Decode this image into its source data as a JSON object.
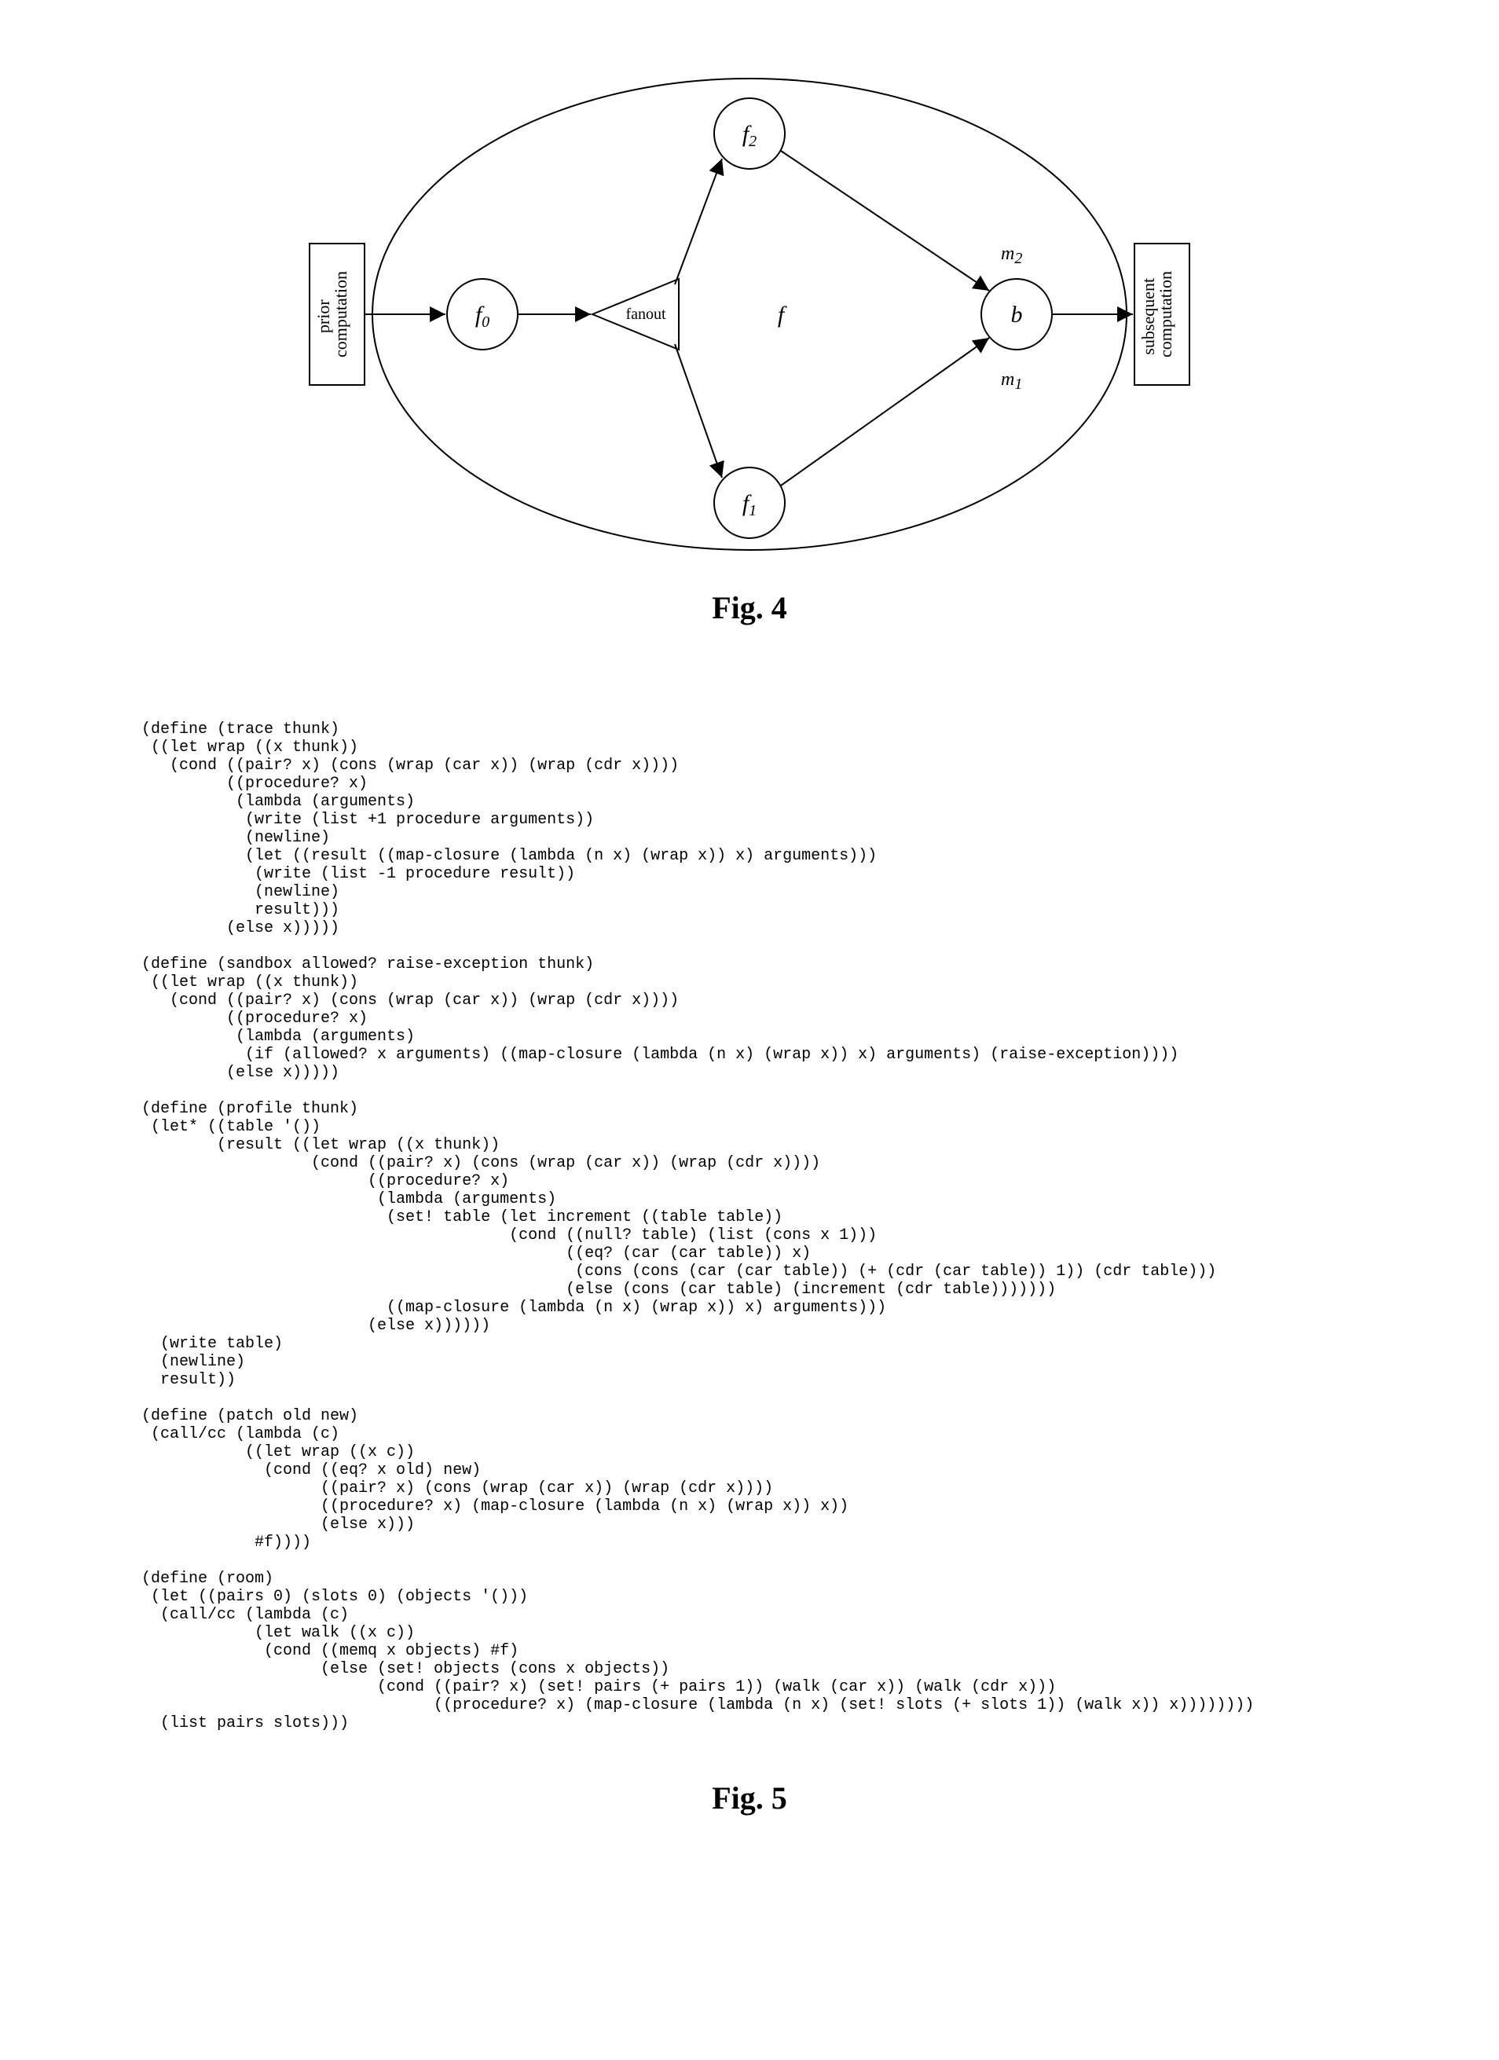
{
  "figure4": {
    "caption": "Fig. 4",
    "nodes": {
      "f0": "f0",
      "f1": "f1",
      "f2": "f2",
      "f": "f",
      "b": "b",
      "fanout": "fanout"
    },
    "edges": {
      "m1": "m1",
      "m2": "m2"
    },
    "boxes": {
      "prior": "prior\ncomputation",
      "subsequent": "subsequent\ncomputation"
    }
  },
  "figure5": {
    "caption": "Fig. 5",
    "code": "(define (trace thunk)\n ((let wrap ((x thunk))\n   (cond ((pair? x) (cons (wrap (car x)) (wrap (cdr x))))\n         ((procedure? x)\n          (lambda (arguments)\n           (write (list +1 procedure arguments))\n           (newline)\n           (let ((result ((map-closure (lambda (n x) (wrap x)) x) arguments)))\n            (write (list -1 procedure result))\n            (newline)\n            result)))\n         (else x)))))\n\n(define (sandbox allowed? raise-exception thunk)\n ((let wrap ((x thunk))\n   (cond ((pair? x) (cons (wrap (car x)) (wrap (cdr x))))\n         ((procedure? x)\n          (lambda (arguments)\n           (if (allowed? x arguments) ((map-closure (lambda (n x) (wrap x)) x) arguments) (raise-exception))))\n         (else x)))))\n\n(define (profile thunk)\n (let* ((table '())\n        (result ((let wrap ((x thunk))\n                  (cond ((pair? x) (cons (wrap (car x)) (wrap (cdr x))))\n                        ((procedure? x)\n                         (lambda (arguments)\n                          (set! table (let increment ((table table))\n                                       (cond ((null? table) (list (cons x 1)))\n                                             ((eq? (car (car table)) x)\n                                              (cons (cons (car (car table)) (+ (cdr (car table)) 1)) (cdr table)))\n                                             (else (cons (car table) (increment (cdr table)))))))\n                          ((map-closure (lambda (n x) (wrap x)) x) arguments)))\n                        (else x))))))\n  (write table)\n  (newline)\n  result))\n\n(define (patch old new)\n (call/cc (lambda (c)\n           ((let wrap ((x c))\n             (cond ((eq? x old) new)\n                   ((pair? x) (cons (wrap (car x)) (wrap (cdr x))))\n                   ((procedure? x) (map-closure (lambda (n x) (wrap x)) x))\n                   (else x)))\n            #f))))\n\n(define (room)\n (let ((pairs 0) (slots 0) (objects '()))\n  (call/cc (lambda (c)\n            (let walk ((x c))\n             (cond ((memq x objects) #f)\n                   (else (set! objects (cons x objects))\n                         (cond ((pair? x) (set! pairs (+ pairs 1)) (walk (car x)) (walk (cdr x)))\n                               ((procedure? x) (map-closure (lambda (n x) (set! slots (+ slots 1)) (walk x)) x))))))))\n  (list pairs slots)))"
  }
}
